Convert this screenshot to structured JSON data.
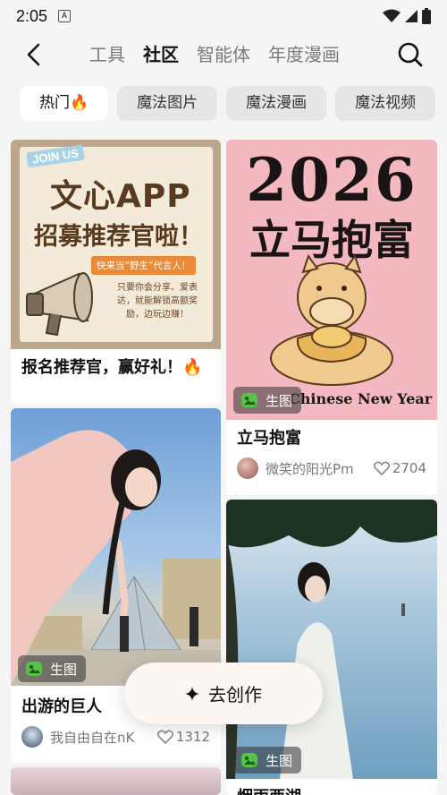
{
  "status_bar": {
    "time": "2:05",
    "app_badge": "A"
  },
  "nav": {
    "tabs": [
      {
        "label": "工具",
        "active": false
      },
      {
        "label": "社区",
        "active": true
      },
      {
        "label": "智能体",
        "active": false
      },
      {
        "label": "年度漫画",
        "active": false
      }
    ]
  },
  "chips": [
    {
      "label": "热门🔥",
      "active": true
    },
    {
      "label": "魔法图片",
      "active": false
    },
    {
      "label": "魔法漫画",
      "active": false
    },
    {
      "label": "魔法视频",
      "active": false
    }
  ],
  "cards": {
    "recruit": {
      "title": "报名推荐官，赢好礼！🔥",
      "poster_tag": "JOIN US",
      "poster_line1": "文心APP",
      "poster_line2": "招募推荐官啦！",
      "poster_ribbon": "快来当“野生”代言人！",
      "poster_body": "只要你会分享、爱表达，就能解锁高额奖励，边玩边赚！"
    },
    "horse": {
      "title": "立马抱富",
      "poster_year": "2026",
      "poster_title": "立马抱富",
      "poster_sub": "Chinese New Year",
      "badge": "生图",
      "author": "微笑的阳光Pm",
      "likes": "2704"
    },
    "giant": {
      "title": "出游的巨人",
      "badge": "生图",
      "author": "我自由自在nK",
      "likes": "1312"
    },
    "lake": {
      "title": "烟雨西湖",
      "badge": "生图"
    }
  },
  "fab": {
    "label": "去创作"
  },
  "colors": {
    "background": "#f6f5f5",
    "card": "#ffffff",
    "poster_pink": "#f4b9c0",
    "poster_cream": "#efe4d2",
    "badge_green": "#56c248"
  }
}
